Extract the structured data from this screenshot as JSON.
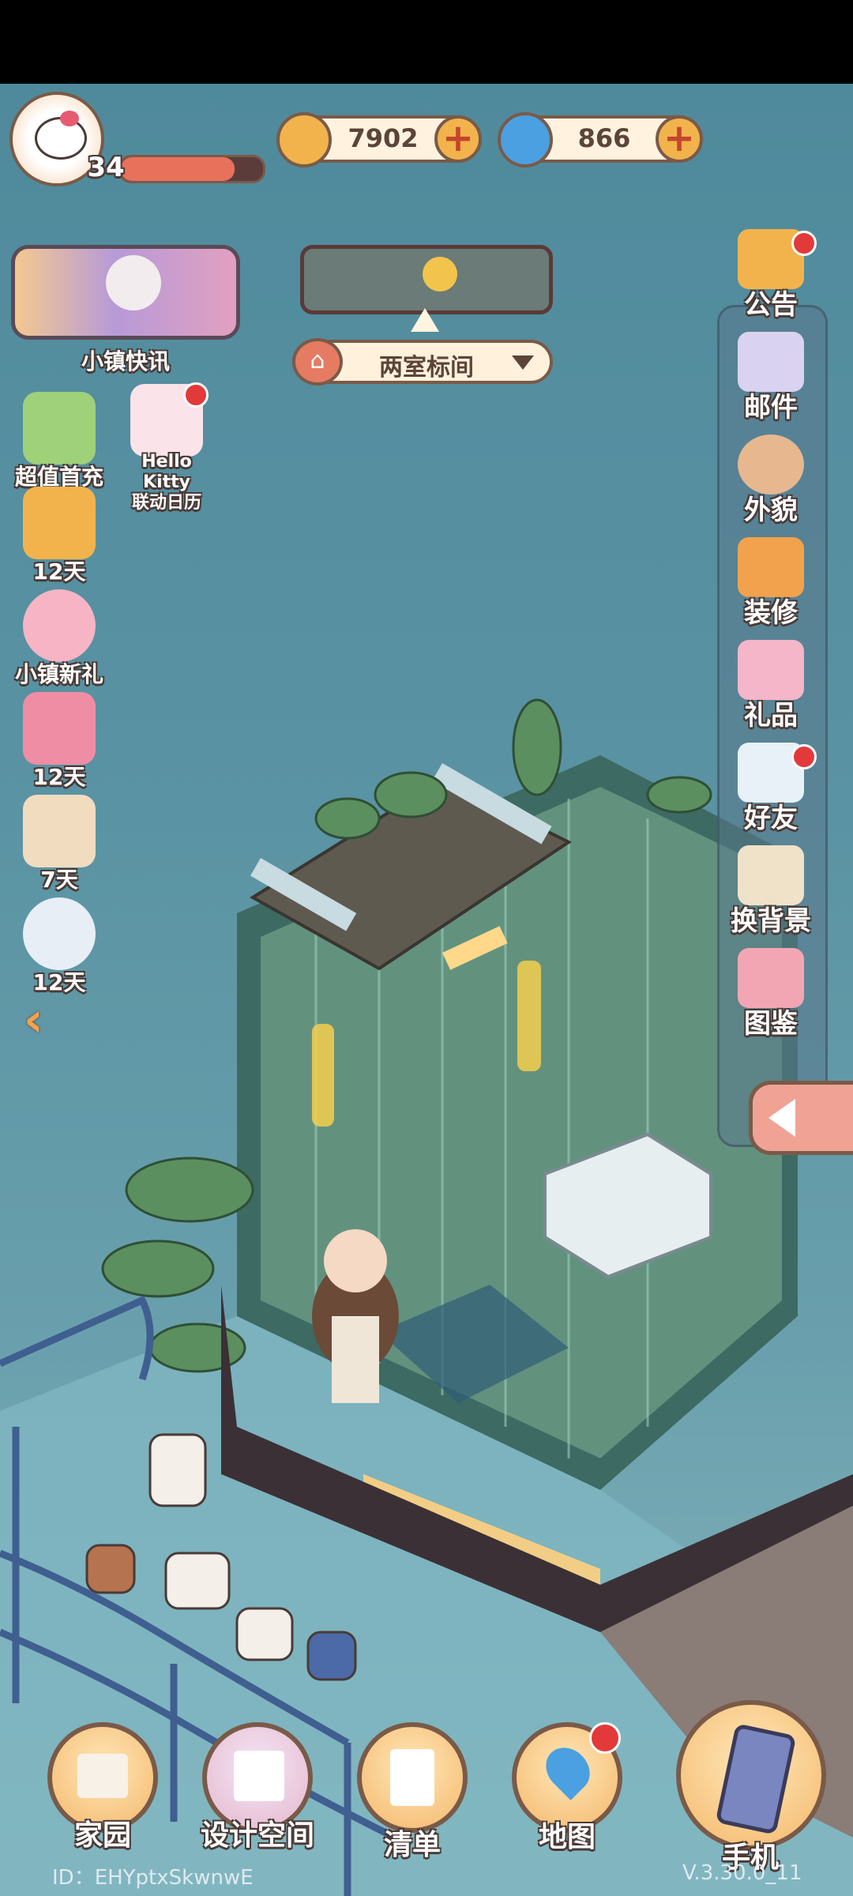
{
  "player": {
    "level": "34"
  },
  "currency": {
    "coins": "7902",
    "gems": "866"
  },
  "news": {
    "label": "小镇快讯"
  },
  "room": {
    "name": "两室标间"
  },
  "left_menu": [
    {
      "label": "超值首充"
    },
    {
      "label": "Hello Kitty\n联动日历"
    },
    {
      "label": "12天"
    },
    {
      "label": "小镇新礼"
    },
    {
      "label": "12天"
    },
    {
      "label": "7天"
    },
    {
      "label": "12天"
    }
  ],
  "right_menu": [
    {
      "label": "公告"
    },
    {
      "label": "邮件"
    },
    {
      "label": "外貌"
    },
    {
      "label": "装修"
    },
    {
      "label": "礼品"
    },
    {
      "label": "好友"
    },
    {
      "label": "换背景"
    },
    {
      "label": "图鉴"
    }
  ],
  "bottom_nav": [
    {
      "label": "家园"
    },
    {
      "label": "设计空间"
    },
    {
      "label": "清单"
    },
    {
      "label": "地图"
    },
    {
      "label": "手机"
    }
  ],
  "footer": {
    "id": "ID：EHYptxSkwnwE",
    "version": "V.3.30.0_11"
  },
  "colors": {
    "accent": "#f2b34c",
    "outline": "#7a5a48",
    "badge": "#e23a3a"
  }
}
